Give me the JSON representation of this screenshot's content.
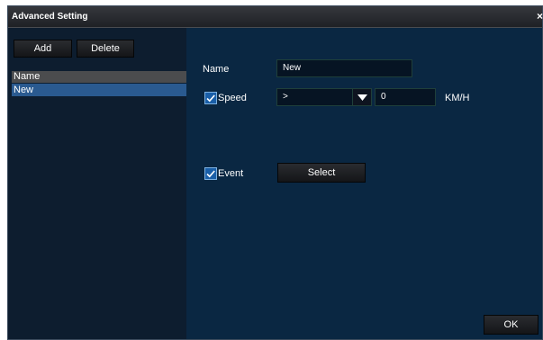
{
  "window": {
    "title": "Advanced Setting",
    "close_glyph": "×"
  },
  "toolbar": {
    "add_label": "Add",
    "delete_label": "Delete"
  },
  "list": {
    "header": "Name",
    "items": [
      "New"
    ]
  },
  "form": {
    "name_label": "Name",
    "name_value": "New",
    "speed_label": "Speed",
    "speed_checked": true,
    "operator_value": ">",
    "speed_value": "0",
    "speed_unit": "KM/H",
    "event_label": "Event",
    "event_checked": true,
    "select_label": "Select"
  },
  "footer": {
    "ok_label": "OK"
  },
  "colors": {
    "accent": "#2a5a90",
    "panel": "#0a2742",
    "checkbox": "#1a5fa8"
  }
}
